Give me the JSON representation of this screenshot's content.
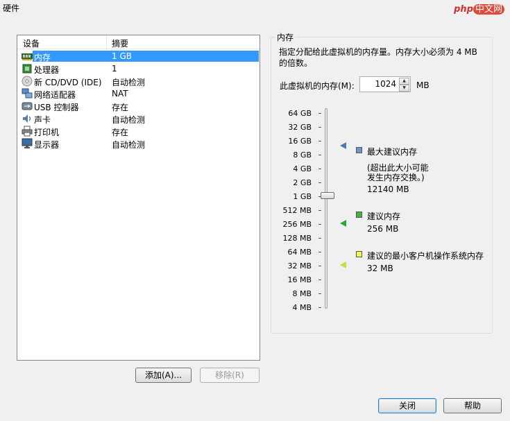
{
  "window": {
    "title": "硬件",
    "watermark_p": "php",
    "watermark_rest": "中文网"
  },
  "devices": {
    "headers": {
      "device": "设备",
      "summary": "摘要"
    },
    "items": [
      {
        "name": "内存",
        "summary": "1 GB",
        "icon": "memory-icon",
        "selected": true
      },
      {
        "name": "处理器",
        "summary": "1",
        "icon": "processor-icon"
      },
      {
        "name": "新 CD/DVD (IDE)",
        "summary": "自动检测",
        "icon": "cd-dvd-icon"
      },
      {
        "name": "网络适配器",
        "summary": "NAT",
        "icon": "network-adapter-icon"
      },
      {
        "name": "USB 控制器",
        "summary": "存在",
        "icon": "usb-icon"
      },
      {
        "name": "声卡",
        "summary": "自动检测",
        "icon": "sound-card-icon"
      },
      {
        "name": "打印机",
        "summary": "存在",
        "icon": "printer-icon"
      },
      {
        "name": "显示器",
        "summary": "自动检测",
        "icon": "display-icon"
      }
    ]
  },
  "buttons": {
    "add": "添加(A)...",
    "remove": "移除(R)",
    "close": "关闭",
    "help": "帮助"
  },
  "memory": {
    "group_title": "内存",
    "description": "指定分配给此虚拟机的内存量。内存大小必须为 4 MB 的倍数。",
    "field_label": "此虚拟机的内存(M):",
    "value": "1024",
    "unit": "MB",
    "slider_ticks": [
      "64 GB",
      "32 GB",
      "16 GB",
      "8 GB",
      "4 GB",
      "2 GB",
      "1 GB",
      "512 MB",
      "256 MB",
      "128 MB",
      "64 MB",
      "32 MB",
      "16 MB",
      "8 MB",
      "4 MB"
    ],
    "legend": {
      "max": {
        "label": "最大建议内存",
        "note_line1": "(超出此大小可能",
        "note_line2": "发生内存交换。)",
        "value": "12140 MB",
        "color": "#4f7ab5"
      },
      "recommended": {
        "label": "建议内存",
        "value": "256 MB",
        "color": "#2fa82f"
      },
      "min_guest": {
        "label": "建议的最小客户机操作系统内存",
        "value": "32 MB",
        "color": "#d8d83a"
      }
    }
  }
}
